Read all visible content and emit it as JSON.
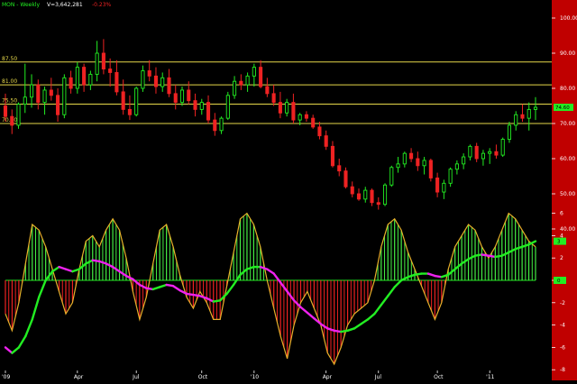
{
  "header": {
    "symbol": "MON - Weekly",
    "volume_text": "V=3,642,281",
    "change_text": "-0.23%"
  },
  "colors": {
    "background": "#000000",
    "up_candle": "#22ee22",
    "down_candle": "#ee2222",
    "level_line": "#e6d84a",
    "osc_outline": "#e6b02a",
    "osc_positive_hatch": "#44ee44",
    "osc_negative_hatch": "#ee2222",
    "signal_up": "#22ee22",
    "signal_down": "#ee22ee",
    "zero_line": "#22ee22",
    "axis_panel": "#c00000",
    "axis_text": "#ffffff",
    "header_symbol": "#22ee22",
    "header_volume": "#ffffff",
    "header_change": "#ee2222"
  },
  "chart_data": [
    {
      "type": "candlestick",
      "title": "MON - Weekly",
      "y_ticks": [
        40,
        50,
        60,
        70,
        80,
        90,
        100
      ],
      "ylim": [
        30,
        105
      ],
      "x_ticks": [
        "'09",
        "Apr",
        "Jul",
        "Oct",
        "'10",
        "Apr",
        "Jul",
        "Oct",
        "'11"
      ],
      "x_tick_index": [
        0,
        11,
        20,
        30,
        38,
        49,
        57,
        66,
        74
      ],
      "horizontal_levels": [
        {
          "value": 87.5,
          "label": "87.50"
        },
        {
          "value": 81.0,
          "label": "81.00"
        },
        {
          "value": 75.5,
          "label": "75.50"
        },
        {
          "value": 70.0,
          "label": "70.00"
        }
      ],
      "last_price_label": "74.60",
      "ohlc": [
        [
          75.0,
          78.5,
          70.5,
          72.0
        ],
        [
          72.0,
          74.0,
          67.0,
          69.5
        ],
        [
          69.5,
          76.0,
          68.5,
          75.5
        ],
        [
          75.5,
          87.0,
          73.0,
          77.5
        ],
        [
          77.5,
          84.0,
          74.5,
          81.0
        ],
        [
          81.0,
          82.5,
          74.0,
          76.0
        ],
        [
          76.0,
          80.5,
          72.5,
          79.5
        ],
        [
          79.5,
          83.0,
          76.5,
          78.0
        ],
        [
          78.0,
          80.0,
          70.5,
          72.5
        ],
        [
          72.5,
          84.0,
          71.5,
          83.0
        ],
        [
          83.0,
          85.0,
          78.5,
          80.0
        ],
        [
          80.0,
          87.5,
          78.5,
          86.0
        ],
        [
          86.0,
          87.0,
          79.0,
          81.0
        ],
        [
          81.0,
          85.0,
          79.5,
          84.0
        ],
        [
          84.0,
          93.5,
          82.0,
          90.0
        ],
        [
          90.0,
          94.0,
          84.0,
          85.5
        ],
        [
          85.5,
          88.5,
          80.5,
          84.5
        ],
        [
          84.5,
          88.0,
          78.0,
          79.0
        ],
        [
          79.0,
          82.5,
          72.5,
          74.0
        ],
        [
          74.0,
          78.0,
          71.0,
          72.5
        ],
        [
          72.5,
          80.5,
          72.0,
          80.0
        ],
        [
          80.0,
          86.5,
          79.0,
          85.0
        ],
        [
          85.0,
          88.0,
          82.0,
          83.5
        ],
        [
          83.5,
          86.0,
          78.5,
          80.5
        ],
        [
          80.5,
          84.5,
          79.0,
          83.0
        ],
        [
          83.0,
          85.5,
          77.5,
          78.5
        ],
        [
          78.5,
          81.0,
          74.0,
          76.0
        ],
        [
          76.0,
          80.5,
          75.0,
          79.5
        ],
        [
          79.5,
          82.0,
          75.5,
          76.5
        ],
        [
          76.5,
          78.5,
          72.0,
          74.0
        ],
        [
          74.0,
          77.0,
          72.5,
          76.0
        ],
        [
          76.0,
          78.0,
          70.0,
          71.0
        ],
        [
          71.0,
          73.0,
          66.5,
          68.0
        ],
        [
          68.0,
          72.0,
          67.0,
          71.5
        ],
        [
          71.5,
          79.0,
          71.0,
          78.0
        ],
        [
          78.0,
          83.5,
          77.0,
          82.0
        ],
        [
          82.0,
          84.0,
          79.5,
          81.0
        ],
        [
          81.0,
          84.5,
          79.0,
          83.5
        ],
        [
          83.5,
          87.0,
          80.5,
          86.0
        ],
        [
          86.0,
          88.0,
          80.0,
          80.5
        ],
        [
          80.5,
          83.0,
          77.5,
          78.5
        ],
        [
          78.5,
          81.0,
          75.0,
          76.0
        ],
        [
          76.0,
          79.0,
          71.5,
          73.0
        ],
        [
          73.0,
          77.0,
          72.0,
          76.0
        ],
        [
          76.0,
          78.5,
          70.0,
          71.0
        ],
        [
          71.0,
          73.0,
          69.5,
          72.5
        ],
        [
          72.5,
          73.5,
          70.5,
          71.5
        ],
        [
          71.5,
          72.5,
          68.5,
          69.0
        ],
        [
          69.0,
          70.5,
          65.5,
          66.5
        ],
        [
          66.5,
          68.0,
          62.5,
          63.5
        ],
        [
          63.5,
          65.0,
          57.5,
          58.0
        ],
        [
          58.0,
          60.0,
          55.0,
          56.5
        ],
        [
          56.5,
          57.5,
          51.5,
          52.0
        ],
        [
          52.0,
          53.5,
          49.0,
          50.0
        ],
        [
          50.0,
          51.5,
          48.0,
          48.5
        ],
        [
          48.5,
          52.0,
          47.5,
          51.0
        ],
        [
          51.0,
          51.5,
          46.5,
          47.5
        ],
        [
          47.5,
          49.0,
          45.5,
          47.0
        ],
        [
          47.0,
          53.0,
          46.5,
          52.5
        ],
        [
          52.5,
          58.0,
          52.0,
          57.5
        ],
        [
          57.5,
          60.5,
          56.0,
          58.5
        ],
        [
          58.5,
          62.0,
          57.5,
          61.5
        ],
        [
          61.5,
          63.0,
          59.0,
          60.0
        ],
        [
          60.0,
          62.0,
          56.5,
          58.0
        ],
        [
          58.0,
          60.5,
          55.5,
          59.5
        ],
        [
          59.5,
          60.0,
          53.5,
          54.5
        ],
        [
          54.5,
          56.0,
          49.0,
          50.5
        ],
        [
          50.5,
          54.0,
          48.5,
          53.0
        ],
        [
          53.0,
          57.5,
          52.0,
          57.0
        ],
        [
          57.0,
          59.5,
          55.5,
          58.5
        ],
        [
          58.5,
          61.5,
          57.0,
          60.5
        ],
        [
          60.5,
          64.0,
          59.5,
          63.5
        ],
        [
          63.5,
          64.5,
          59.0,
          60.0
        ],
        [
          60.0,
          62.5,
          58.0,
          61.5
        ],
        [
          61.5,
          63.0,
          58.5,
          62.0
        ],
        [
          62.0,
          64.0,
          60.0,
          61.0
        ],
        [
          61.0,
          66.0,
          60.5,
          65.5
        ],
        [
          65.5,
          70.5,
          64.5,
          69.5
        ],
        [
          69.5,
          73.5,
          68.0,
          72.5
        ],
        [
          72.5,
          75.5,
          70.5,
          71.5
        ],
        [
          71.5,
          76.0,
          68.0,
          74.0
        ],
        [
          74.0,
          77.5,
          71.0,
          74.6
        ]
      ]
    },
    {
      "type": "oscillator",
      "y_ticks": [
        -8,
        -6,
        -4,
        -2,
        0,
        2,
        4,
        6
      ],
      "ylim": [
        -9,
        7
      ],
      "zero_label": "0",
      "last_value_label": "3",
      "histogram": [
        -3.0,
        -4.5,
        -2.0,
        1.5,
        5.0,
        4.5,
        3.0,
        1.0,
        -1.0,
        -3.0,
        -2.0,
        1.0,
        3.5,
        4.0,
        3.0,
        4.5,
        5.5,
        4.5,
        2.0,
        -1.0,
        -3.5,
        -1.5,
        1.5,
        4.5,
        5.0,
        3.0,
        0.5,
        -1.5,
        -2.5,
        -1.0,
        -2.0,
        -3.5,
        -3.5,
        -0.5,
        2.5,
        5.5,
        6.0,
        5.0,
        3.0,
        0.0,
        -2.5,
        -5.0,
        -7.0,
        -4.0,
        -2.0,
        -1.0,
        -2.5,
        -4.0,
        -6.5,
        -7.5,
        -6.0,
        -4.0,
        -3.0,
        -2.5,
        -2.0,
        0.0,
        3.0,
        5.0,
        5.5,
        4.5,
        2.5,
        1.0,
        -0.5,
        -2.0,
        -3.5,
        -2.0,
        1.0,
        3.0,
        4.0,
        5.0,
        4.5,
        3.0,
        2.0,
        3.0,
        4.5,
        6.0,
        5.5,
        4.5,
        3.5,
        3.0
      ],
      "signal": [
        -6.0,
        -6.5,
        -6.0,
        -5.0,
        -3.5,
        -1.5,
        0.0,
        0.8,
        1.2,
        1.0,
        0.8,
        1.0,
        1.5,
        1.8,
        1.7,
        1.5,
        1.2,
        0.8,
        0.4,
        0.1,
        -0.4,
        -0.7,
        -0.8,
        -0.6,
        -0.4,
        -0.5,
        -0.9,
        -1.2,
        -1.3,
        -1.4,
        -1.6,
        -1.9,
        -1.8,
        -1.2,
        -0.4,
        0.5,
        1.0,
        1.2,
        1.2,
        1.0,
        0.6,
        -0.2,
        -1.0,
        -1.8,
        -2.4,
        -2.9,
        -3.4,
        -3.9,
        -4.3,
        -4.5,
        -4.6,
        -4.5,
        -4.3,
        -3.9,
        -3.5,
        -3.0,
        -2.2,
        -1.4,
        -0.6,
        0.0,
        0.3,
        0.5,
        0.6,
        0.6,
        0.4,
        0.3,
        0.5,
        1.0,
        1.5,
        1.9,
        2.2,
        2.3,
        2.2,
        2.1,
        2.2,
        2.5,
        2.8,
        3.0,
        3.2,
        3.5
      ]
    }
  ]
}
